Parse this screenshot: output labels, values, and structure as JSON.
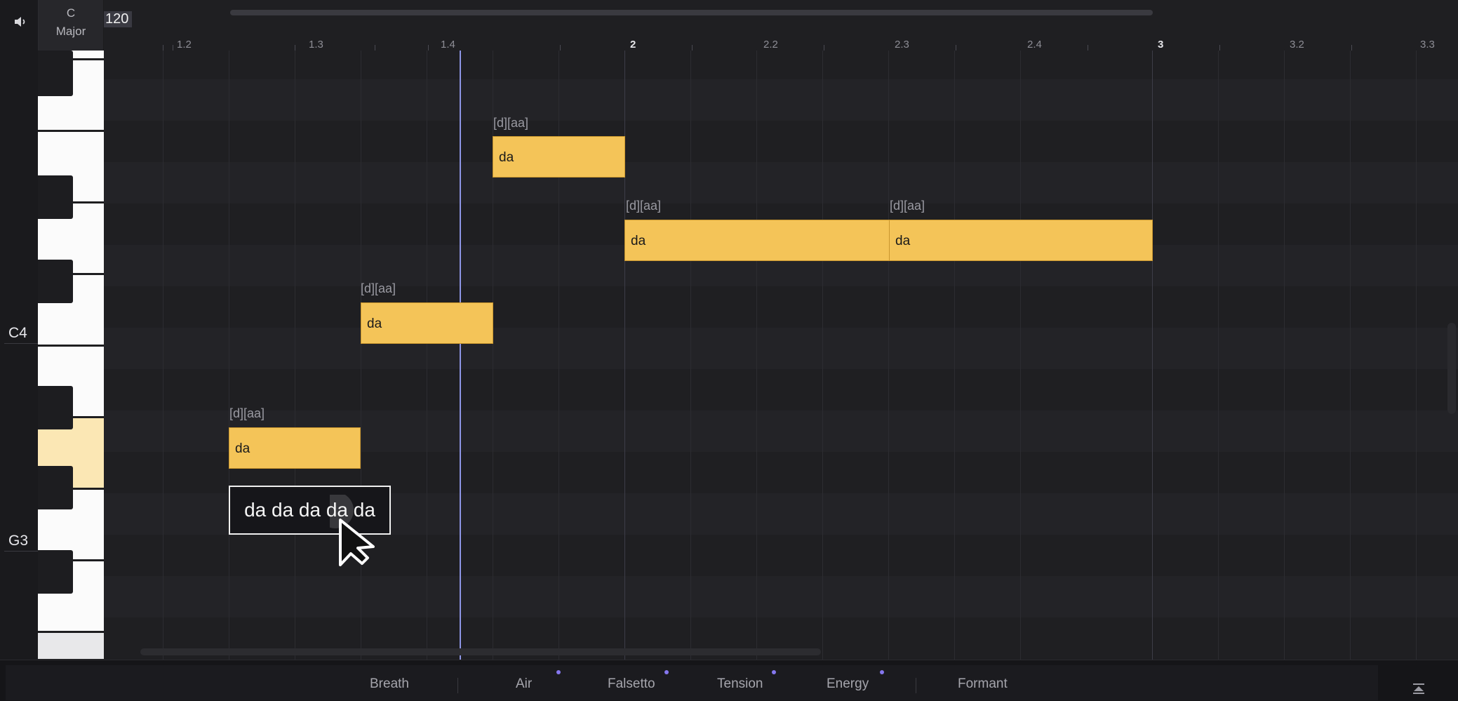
{
  "header": {
    "key_note": "C",
    "key_mode": "Major",
    "tempo": "120"
  },
  "piano": {
    "octave_labels": [
      "C4",
      "G3"
    ]
  },
  "ruler": {
    "markers": [
      "1.2",
      "1.3",
      "1.4",
      "2",
      "2.2",
      "2.3",
      "2.4",
      "3",
      "3.2",
      "3.3"
    ]
  },
  "notes": [
    {
      "lyric": "da",
      "phonemes": "[d][aa]"
    },
    {
      "lyric": "da",
      "phonemes": "[d][aa]"
    },
    {
      "lyric": "da",
      "phonemes": "[d][aa]"
    },
    {
      "lyric": "da",
      "phonemes": "[d][aa]"
    },
    {
      "lyric": "da",
      "phonemes": "[d][aa]"
    }
  ],
  "lyric_input": {
    "value": "da da da da da"
  },
  "param_tabs": [
    {
      "label": "Breath",
      "has_dot": false
    },
    {
      "label": "Air",
      "has_dot": true
    },
    {
      "label": "Falsetto",
      "has_dot": true
    },
    {
      "label": "Tension",
      "has_dot": true
    },
    {
      "label": "Energy",
      "has_dot": true
    },
    {
      "label": "Formant",
      "has_dot": false
    }
  ],
  "colors": {
    "note_fill": "#f4c458",
    "playhead": "#8e96e6",
    "param_dot": "#8577ee",
    "highlight_key": "#fbe7b4"
  }
}
